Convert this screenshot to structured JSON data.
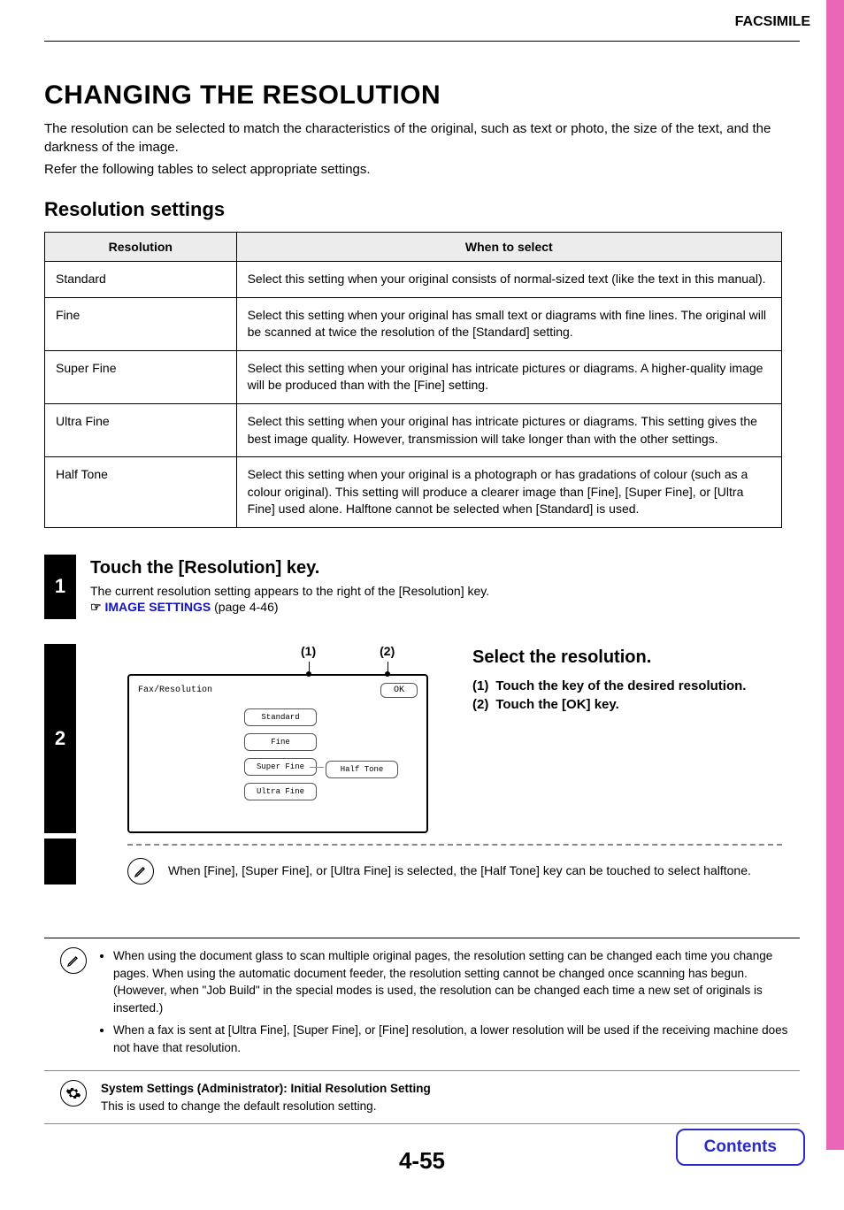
{
  "header": {
    "section": "FACSIMILE"
  },
  "title": "CHANGING THE RESOLUTION",
  "intro": {
    "p1": "The resolution can be selected to match the characteristics of the original, such as text or photo, the size of the text, and the darkness of the image.",
    "p2": "Refer the following tables to select appropriate settings."
  },
  "subtitle": "Resolution settings",
  "table": {
    "headers": [
      "Resolution",
      "When to select"
    ],
    "rows": [
      {
        "res": "Standard",
        "desc": "Select this setting when your original consists of normal-sized text (like the text in this manual)."
      },
      {
        "res": "Fine",
        "desc": "Select this setting when your original has small text or diagrams with fine lines.\nThe original will be scanned at twice the resolution of the [Standard] setting."
      },
      {
        "res": "Super Fine",
        "desc": "Select this setting when your original has intricate pictures or diagrams.\nA higher-quality image will be produced than with the [Fine] setting."
      },
      {
        "res": "Ultra Fine",
        "desc": "Select this setting when your original has intricate pictures or diagrams.\nThis setting gives the best image quality. However, transmission will take longer than with the other settings."
      },
      {
        "res": "Half Tone",
        "desc": "Select this setting when your original is a photograph or has gradations of colour (such as a colour original).\nThis setting will produce a clearer image than [Fine], [Super Fine], or [Ultra Fine] used alone.\nHalftone cannot be selected when [Standard] is used."
      }
    ]
  },
  "steps": [
    {
      "num": "1",
      "title": "Touch the [Resolution] key.",
      "text": "The current resolution setting appears to the right of the [Resolution] key.",
      "xref_label": "IMAGE SETTINGS",
      "xref_page": " (page 4-46)"
    },
    {
      "num": "2",
      "title": "Select the resolution.",
      "callouts": [
        "(1)",
        "(2)"
      ],
      "sub": [
        {
          "m": "(1)",
          "t": "Touch the key of the desired resolution."
        },
        {
          "m": "(2)",
          "t": "Touch the [OK] key."
        }
      ],
      "note": "When [Fine], [Super Fine], or [Ultra Fine] is selected, the [Half Tone] key can be touched to select halftone."
    }
  ],
  "panel": {
    "breadcrumb": "Fax/Resolution",
    "ok": "OK",
    "buttons": [
      "Standard",
      "Fine",
      "Super Fine",
      "Ultra Fine"
    ],
    "halftone": "Half Tone"
  },
  "notes": {
    "bullets": [
      "When using the document glass to scan multiple original pages, the resolution setting can be changed each time you change pages. When using the automatic document feeder, the resolution setting cannot be changed once scanning has begun. (However, when \"Job Build\" in the special modes is used, the resolution can be changed each time a new set of originals is inserted.)",
      "When a fax is sent at [Ultra Fine], [Super Fine], or [Fine] resolution, a lower resolution will be used if the receiving machine does not have that resolution."
    ],
    "admin": {
      "title": "System Settings (Administrator): Initial Resolution Setting",
      "body": "This is used to change the default resolution setting."
    }
  },
  "page_number": "4-55",
  "contents_label": "Contents"
}
